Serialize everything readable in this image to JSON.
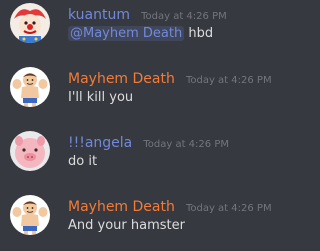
{
  "colors": {
    "background": "#36393f",
    "text": "#dcddde",
    "timestamp": "#72767d",
    "mention": "#7289da"
  },
  "messages": [
    {
      "username": "kuantum",
      "username_color": "#7289da",
      "timestamp": "Today at 4:26 PM",
      "mention": "@Mayhem Death",
      "text": " hbd",
      "avatar_icon": "clown-avatar"
    },
    {
      "username": "Mayhem Death",
      "username_color": "#f47b39",
      "timestamp": "Today at 4:26 PM",
      "text": "I'll kill you",
      "avatar_icon": "muscle-man-avatar"
    },
    {
      "username": "!!!angela",
      "username_color": "#7289da",
      "timestamp": "Today at 4:26 PM",
      "text": "do it",
      "avatar_icon": "pink-pig-avatar"
    },
    {
      "username": "Mayhem Death",
      "username_color": "#f47b39",
      "timestamp": "Today at 4:26 PM",
      "text": "And your hamster",
      "avatar_icon": "muscle-man-avatar"
    }
  ]
}
